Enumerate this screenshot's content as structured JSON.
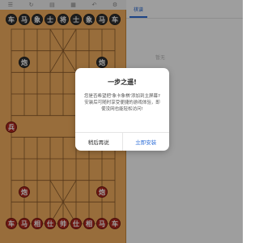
{
  "toolbar": {
    "icons": [
      "menu-icon",
      "refresh-icon",
      "book-icon",
      "grid-icon",
      "undo-icon",
      "settings-icon"
    ]
  },
  "board": {
    "river_text": "",
    "top_pieces": [
      {
        "label": "车",
        "color": "black"
      },
      {
        "label": "马",
        "color": "black"
      },
      {
        "label": "象",
        "color": "black"
      },
      {
        "label": "士",
        "color": "black"
      },
      {
        "label": "将",
        "color": "black"
      },
      {
        "label": "士",
        "color": "black"
      },
      {
        "label": "象",
        "color": "black"
      },
      {
        "label": "马",
        "color": "black"
      },
      {
        "label": "车",
        "color": "black"
      },
      {
        "label": "炮",
        "color": "black"
      },
      {
        "label": "炮",
        "color": "black"
      }
    ],
    "bottom_pieces": [
      {
        "label": "兵",
        "color": "red"
      },
      {
        "label": "炮",
        "color": "red"
      },
      {
        "label": "炮",
        "color": "red"
      },
      {
        "label": "车",
        "color": "red"
      },
      {
        "label": "马",
        "color": "red"
      },
      {
        "label": "相",
        "color": "red"
      },
      {
        "label": "仕",
        "color": "red"
      },
      {
        "label": "帅",
        "color": "red"
      },
      {
        "label": "仕",
        "color": "red"
      },
      {
        "label": "相",
        "color": "red"
      },
      {
        "label": "马",
        "color": "red"
      },
      {
        "label": "车",
        "color": "red"
      }
    ]
  },
  "panel": {
    "tabs": [
      "棋谱",
      "",
      "",
      ""
    ],
    "hint": "暂无"
  },
  "dialog": {
    "title": "一步之遥!",
    "message": "您是否希望把'象卡象棋'添加到主屏幕?安装后可随时享受便捷的游戏体验，即使没网也能轻松访问!",
    "later_label": "稍后再说",
    "install_label": "立即安装"
  }
}
